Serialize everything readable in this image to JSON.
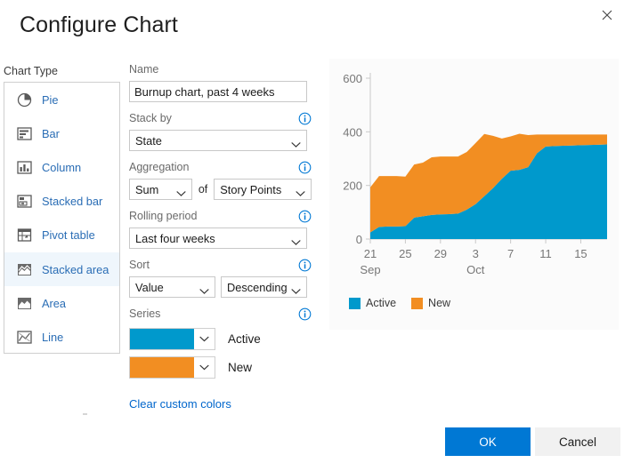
{
  "dialog": {
    "title": "Configure Chart",
    "close_icon": "close-icon"
  },
  "chart_type": {
    "label": "Chart Type",
    "selected": "Stacked area",
    "items": [
      {
        "label": "Pie",
        "icon": "pie-chart-icon"
      },
      {
        "label": "Bar",
        "icon": "bar-chart-icon"
      },
      {
        "label": "Column",
        "icon": "column-chart-icon"
      },
      {
        "label": "Stacked bar",
        "icon": "stacked-bar-chart-icon"
      },
      {
        "label": "Pivot table",
        "icon": "pivot-table-icon"
      },
      {
        "label": "Stacked area",
        "icon": "stacked-area-chart-icon"
      },
      {
        "label": "Area",
        "icon": "area-chart-icon"
      },
      {
        "label": "Line",
        "icon": "line-chart-icon"
      }
    ]
  },
  "form": {
    "name": {
      "label": "Name",
      "value": "Burnup chart, past 4 weeks",
      "placeholder": ""
    },
    "stack_by": {
      "label": "Stack by",
      "value": "State",
      "info_icon": "info-icon"
    },
    "aggregation": {
      "label": "Aggregation",
      "function_value": "Sum",
      "of_word": "of",
      "field_value": "Story Points",
      "info_icon": "info-icon"
    },
    "rolling_period": {
      "label": "Rolling period",
      "value": "Last four weeks",
      "info_icon": "info-icon"
    },
    "sort": {
      "label": "Sort",
      "by_value": "Value",
      "direction_value": "Descending",
      "info_icon": "info-icon"
    },
    "series": {
      "label": "Series",
      "info_icon": "info-icon",
      "items": [
        {
          "name": "Active",
          "color": "#0099CC"
        },
        {
          "name": "New",
          "color": "#F28E22"
        }
      ]
    },
    "clear_colors_link": "Clear custom colors"
  },
  "footer": {
    "ok_label": "OK",
    "cancel_label": "Cancel",
    "ok_color": "#0078d4"
  },
  "chart_data": {
    "type": "area",
    "stacked": true,
    "title": "",
    "xlabel": "",
    "ylabel": "",
    "ylim": [
      0,
      600
    ],
    "yticks": [
      0,
      200,
      400,
      600
    ],
    "ytick_labels": [
      "0",
      "200",
      "400",
      "600"
    ],
    "grid": false,
    "legend_position": "bottom-left",
    "x_month_labels": [
      {
        "text": "Sep",
        "at_tick": "21"
      },
      {
        "text": "Oct",
        "at_tick": "3"
      }
    ],
    "xticks": [
      "21",
      "25",
      "29",
      "3",
      "7",
      "11",
      "15"
    ],
    "x": [
      "Sep 21",
      "Sep 22",
      "Sep 23",
      "Sep 24",
      "Sep 25",
      "Sep 26",
      "Sep 27",
      "Sep 28",
      "Sep 29",
      "Sep 30",
      "Oct 1",
      "Oct 2",
      "Oct 3",
      "Oct 4",
      "Oct 5",
      "Oct 6",
      "Oct 7",
      "Oct 8",
      "Oct 9",
      "Oct 10",
      "Oct 11",
      "Oct 12",
      "Oct 13",
      "Oct 14",
      "Oct 15",
      "Oct 16",
      "Oct 17",
      "Oct 18"
    ],
    "series": [
      {
        "name": "Active",
        "color": "#0099CC",
        "values": [
          25,
          45,
          47,
          47,
          48,
          80,
          85,
          90,
          92,
          93,
          95,
          110,
          130,
          160,
          190,
          225,
          255,
          258,
          268,
          320,
          345,
          347,
          348,
          349,
          350,
          351,
          352,
          353
        ]
      },
      {
        "name": "New",
        "color": "#F28E22",
        "values": [
          168,
          190,
          188,
          188,
          185,
          198,
          200,
          215,
          216,
          215,
          213,
          215,
          228,
          232,
          195,
          150,
          128,
          135,
          120,
          70,
          45,
          43,
          42,
          41,
          40,
          39,
          38,
          37
        ]
      }
    ],
    "totals": [
      193,
      235,
      235,
      235,
      233,
      278,
      285,
      305,
      308,
      308,
      308,
      325,
      358,
      392,
      385,
      375,
      383,
      393,
      388,
      390,
      390,
      390,
      390,
      390,
      390,
      390,
      390,
      390
    ]
  }
}
